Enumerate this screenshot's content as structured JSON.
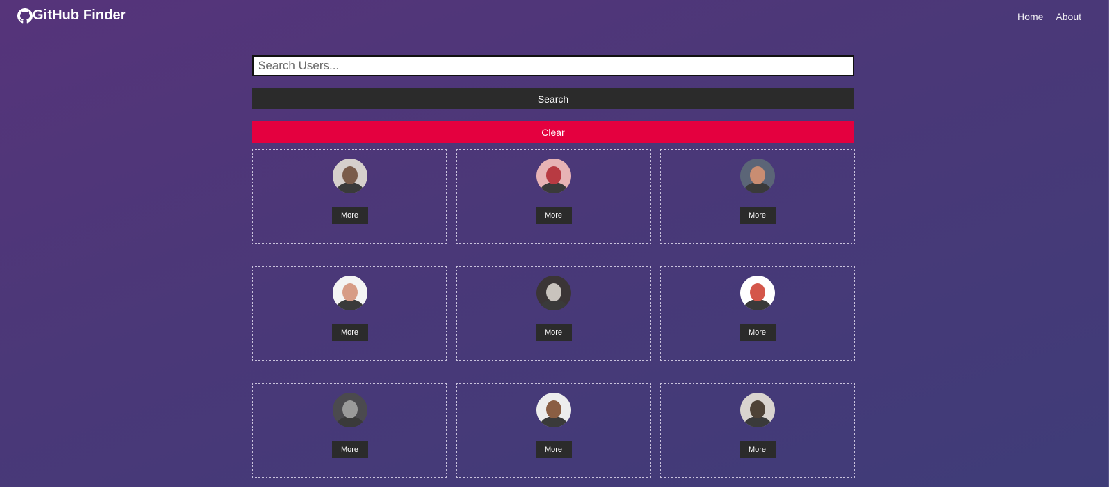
{
  "navbar": {
    "brand": "GitHub Finder",
    "brand_icon": "github-icon",
    "links": [
      {
        "label": "Home"
      },
      {
        "label": "About"
      }
    ]
  },
  "search": {
    "placeholder": "Search Users...",
    "value": "",
    "search_label": "Search",
    "clear_label": "Clear"
  },
  "colors": {
    "background_start": "#56347a",
    "background_end": "#3f3c78",
    "dark_button": "#2b2b2b",
    "clear_button": "#e4003f"
  },
  "users": [
    {
      "more_label": "More",
      "avatar_tone": "#7a5c4a",
      "avatar_bg": "#d6d0cc"
    },
    {
      "more_label": "More",
      "avatar_tone": "#b83a42",
      "avatar_bg": "#e7b3b5"
    },
    {
      "more_label": "More",
      "avatar_tone": "#c98d72",
      "avatar_bg": "#5b6577"
    },
    {
      "more_label": "More",
      "avatar_tone": "#d79c86",
      "avatar_bg": "#f4f4f4"
    },
    {
      "more_label": "More",
      "avatar_tone": "#c9c3bd",
      "avatar_bg": "#3b3536"
    },
    {
      "more_label": "More",
      "avatar_tone": "#d4564a",
      "avatar_bg": "#ffffff"
    },
    {
      "more_label": "More",
      "avatar_tone": "#9a9a9a",
      "avatar_bg": "#4b4a4e"
    },
    {
      "more_label": "More",
      "avatar_tone": "#8a5e43",
      "avatar_bg": "#ededed"
    },
    {
      "more_label": "More",
      "avatar_tone": "#4e4236",
      "avatar_bg": "#d9d4cf"
    }
  ]
}
